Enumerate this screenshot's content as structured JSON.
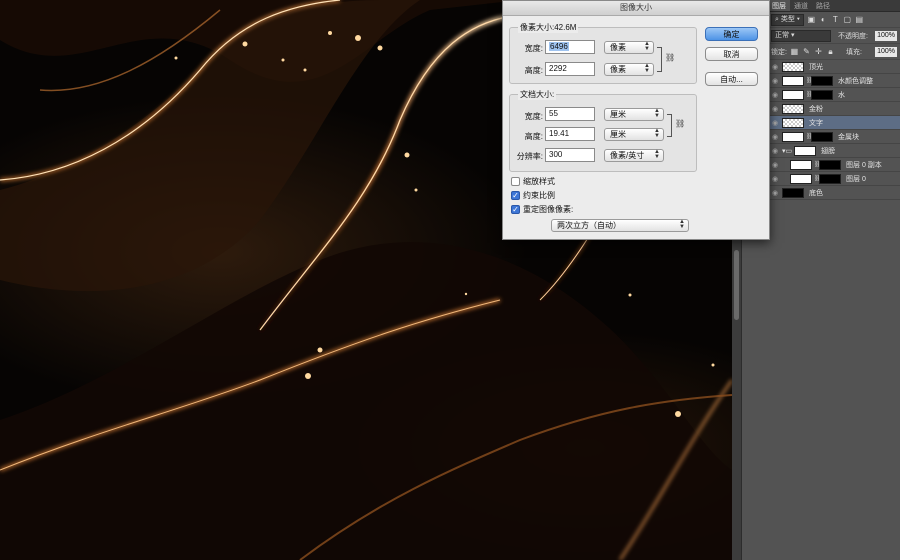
{
  "dialog": {
    "title": "图像大小",
    "pixel_group_title": "像素大小:42.6M",
    "pixel_width_label": "宽度:",
    "pixel_width_value": "6496",
    "pixel_width_unit": "像素",
    "pixel_height_label": "高度:",
    "pixel_height_value": "2292",
    "pixel_height_unit": "像素",
    "doc_group_title": "文档大小:",
    "doc_width_label": "宽度:",
    "doc_width_value": "55",
    "doc_width_unit": "厘米",
    "doc_height_label": "高度:",
    "doc_height_value": "19.41",
    "doc_height_unit": "厘米",
    "resolution_label": "分辨率:",
    "resolution_value": "300",
    "resolution_unit": "像素/英寸",
    "scale_styles_label": "缩放样式",
    "scale_styles_checked": false,
    "constrain_label": "约束比例",
    "constrain_checked": true,
    "resample_label": "重定图像像素:",
    "resample_checked": true,
    "resample_method": "两次立方（自动）",
    "ok_label": "确定",
    "cancel_label": "取消",
    "auto_label": "自动..."
  },
  "layers_panel": {
    "tabs": [
      "图层",
      "通道",
      "路径"
    ],
    "filter_kind": "类型",
    "blend_mode": "正常",
    "opacity_label": "不透明度:",
    "opacity_value": "100%",
    "lock_label": "锁定:",
    "fill_label": "填充:",
    "fill_value": "100%",
    "layers": [
      {
        "name": "顶光",
        "thumb": "check",
        "selected": false
      },
      {
        "name": "水颜色调整",
        "thumb": "adjust",
        "selected": false
      },
      {
        "name": "水",
        "thumb": "mask",
        "selected": false
      },
      {
        "name": "金粉",
        "thumb": "check",
        "selected": false
      },
      {
        "name": "文字",
        "thumb": "check",
        "selected": true
      },
      {
        "name": "金属块",
        "thumb": "mask",
        "selected": false
      },
      {
        "name": "翅膀",
        "thumb": "group",
        "selected": false
      },
      {
        "name": "图层 0 副本",
        "thumb": "mask",
        "selected": false
      },
      {
        "name": "图层 0",
        "thumb": "mask",
        "selected": false
      },
      {
        "name": "底色",
        "thumb": "dark",
        "selected": false
      }
    ]
  },
  "colors": {
    "accent": "#4d93e6",
    "gold": "#e8a05a",
    "canvas_bg": "#060403"
  }
}
